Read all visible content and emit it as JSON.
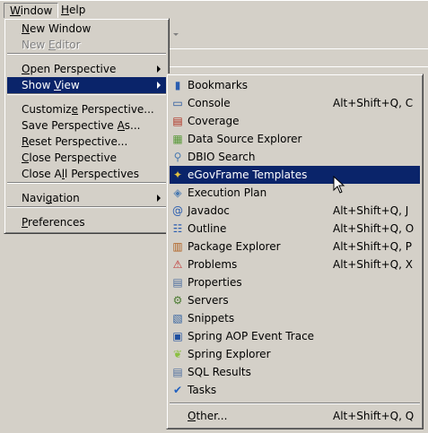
{
  "menubar": {
    "items": [
      {
        "label": "Window",
        "mnemonic": 0
      },
      {
        "label": "Help",
        "mnemonic": 0
      }
    ]
  },
  "window_menu": {
    "items": [
      {
        "label": "New Window",
        "mnemonic": 0
      },
      {
        "label": "New Editor",
        "mnemonic": 4,
        "disabled": true
      },
      {
        "label": "Open Perspective",
        "mnemonic": 0,
        "submenu": true
      },
      {
        "label": "Show View",
        "mnemonic": 5,
        "submenu": true,
        "highlighted": true
      },
      {
        "label": "Customize Perspective...",
        "mnemonic": 8
      },
      {
        "label": "Save Perspective As...",
        "mnemonic": 17
      },
      {
        "label": "Reset Perspective...",
        "mnemonic": 0
      },
      {
        "label": "Close Perspective",
        "mnemonic": 0
      },
      {
        "label": "Close All Perspectives",
        "mnemonic": 7
      },
      {
        "label": "Navigation",
        "mnemonic": 4,
        "submenu": true
      },
      {
        "label": "Preferences",
        "mnemonic": 0
      }
    ]
  },
  "show_view_menu": {
    "items": [
      {
        "label": "Bookmarks",
        "icon": "bookmarks-icon",
        "shortcut": ""
      },
      {
        "label": "Console",
        "icon": "console-icon",
        "shortcut": "Alt+Shift+Q, C"
      },
      {
        "label": "Coverage",
        "icon": "coverage-icon",
        "shortcut": ""
      },
      {
        "label": "Data Source Explorer",
        "icon": "data-source-icon",
        "shortcut": ""
      },
      {
        "label": "DBIO Search",
        "icon": "search-icon",
        "shortcut": ""
      },
      {
        "label": "eGovFrame Templates",
        "icon": "templates-icon",
        "shortcut": "",
        "highlighted": true
      },
      {
        "label": "Execution Plan",
        "icon": "execution-plan-icon",
        "shortcut": ""
      },
      {
        "label": "Javadoc",
        "icon": "javadoc-icon",
        "shortcut": "Alt+Shift+Q, J"
      },
      {
        "label": "Outline",
        "icon": "outline-icon",
        "shortcut": "Alt+Shift+Q, O"
      },
      {
        "label": "Package Explorer",
        "icon": "package-explorer-icon",
        "shortcut": "Alt+Shift+Q, P"
      },
      {
        "label": "Problems",
        "icon": "problems-icon",
        "shortcut": "Alt+Shift+Q, X"
      },
      {
        "label": "Properties",
        "icon": "properties-icon",
        "shortcut": ""
      },
      {
        "label": "Servers",
        "icon": "servers-icon",
        "shortcut": ""
      },
      {
        "label": "Snippets",
        "icon": "snippets-icon",
        "shortcut": ""
      },
      {
        "label": "Spring AOP Event Trace",
        "icon": "aop-trace-icon",
        "shortcut": ""
      },
      {
        "label": "Spring Explorer",
        "icon": "spring-leaf-icon",
        "shortcut": ""
      },
      {
        "label": "SQL Results",
        "icon": "sql-results-icon",
        "shortcut": ""
      },
      {
        "label": "Tasks",
        "icon": "tasks-icon",
        "shortcut": ""
      }
    ],
    "other": {
      "label": "Other...",
      "mnemonic": 0,
      "shortcut": "Alt+Shift+Q, Q"
    }
  },
  "colors": {
    "highlight": "#0a246a",
    "background": "#d4d0c8"
  }
}
